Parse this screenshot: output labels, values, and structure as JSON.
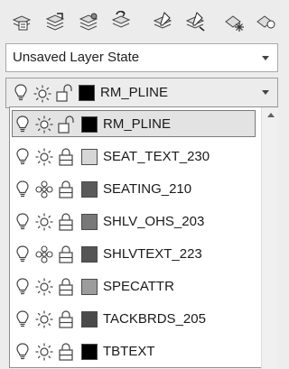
{
  "layer_state": {
    "value": "Unsaved Layer State"
  },
  "current_layer": {
    "name": "RM_PLINE",
    "color": "#000000"
  },
  "toolbar": {
    "buttons": [
      {
        "name": "layer-properties-icon"
      },
      {
        "name": "set-current-layer-icon"
      },
      {
        "name": "layer-state-icon"
      },
      {
        "name": "layer-previous-icon"
      },
      {
        "name": "layer-isolate-icon"
      },
      {
        "name": "layer-unisolate-icon"
      },
      {
        "name": "layer-freeze-icon"
      },
      {
        "name": "layer-off-icon"
      }
    ]
  },
  "layers": [
    {
      "name": "RM_PLINE",
      "color": "#000000",
      "frozen": false,
      "locked": false,
      "selected": true
    },
    {
      "name": "SEAT_TEXT_230",
      "color": "#d6d6d6",
      "frozen": false,
      "locked": true
    },
    {
      "name": "SEATING_210",
      "color": "#5a5a5a",
      "frozen": true,
      "locked": true
    },
    {
      "name": "SHLV_OHS_203",
      "color": "#787878",
      "frozen": false,
      "locked": true
    },
    {
      "name": "SHLVTEXT_223",
      "color": "#555555",
      "frozen": true,
      "locked": true
    },
    {
      "name": "SPECATTR",
      "color": "#9c9c9c",
      "frozen": false,
      "locked": true
    },
    {
      "name": "TACKBRDS_205",
      "color": "#4a4a4a",
      "frozen": false,
      "locked": true
    },
    {
      "name": "TBTEXT",
      "color": "#000000",
      "frozen": false,
      "locked": true
    }
  ]
}
